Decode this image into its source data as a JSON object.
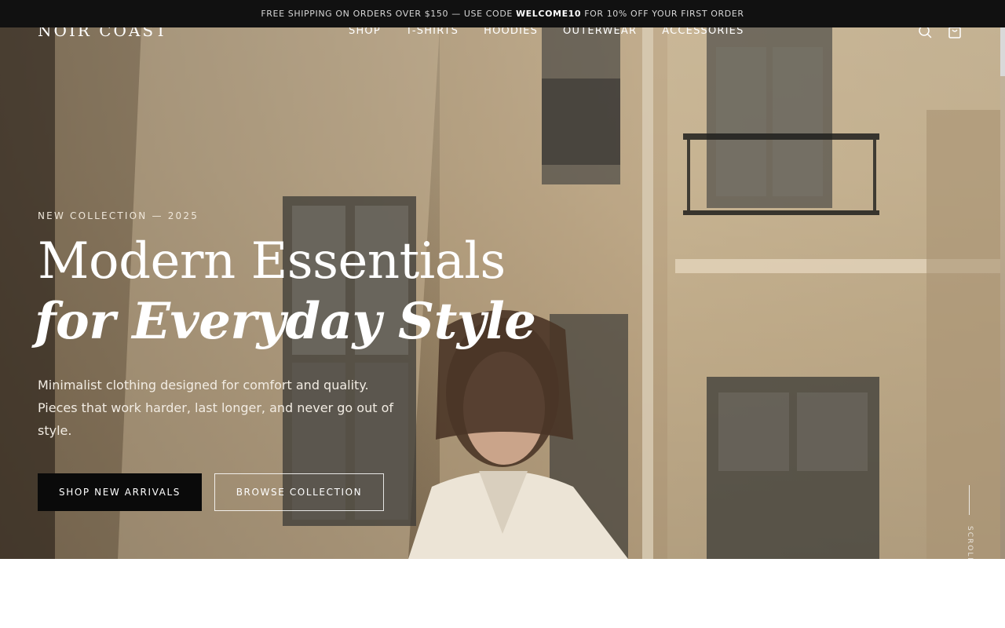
{
  "announcement": {
    "prefix": "FREE SHIPPING ON ORDERS OVER $150 — USE CODE",
    "code": "WELCOME10",
    "suffix": "FOR 10% OFF YOUR FIRST ORDER"
  },
  "brand": {
    "logo": "NOIR COAST"
  },
  "nav": {
    "items": [
      {
        "label": "SHOP"
      },
      {
        "label": "T-SHIRTS"
      },
      {
        "label": "HOODIES"
      },
      {
        "label": "OUTERWEAR"
      },
      {
        "label": "ACCESSORIES"
      }
    ]
  },
  "header_icons": {
    "search": "search-icon",
    "cart": "shopping-bag-icon"
  },
  "hero": {
    "eyebrow": "NEW COLLECTION — 2025",
    "title_line1": "Modern Essentials",
    "title_line2": "for Everyday Style",
    "lede": "Minimalist clothing designed for comfort and quality. Pieces that work harder, last longer, and never go out of style.",
    "primary_cta": "SHOP NEW ARRIVALS",
    "secondary_cta": "BROWSE COLLECTION",
    "scroll_label": "SCROLL"
  },
  "colors": {
    "announcement_bg": "#111111",
    "primary_button_bg": "#0a0a0a",
    "text_light": "#ffffff"
  }
}
